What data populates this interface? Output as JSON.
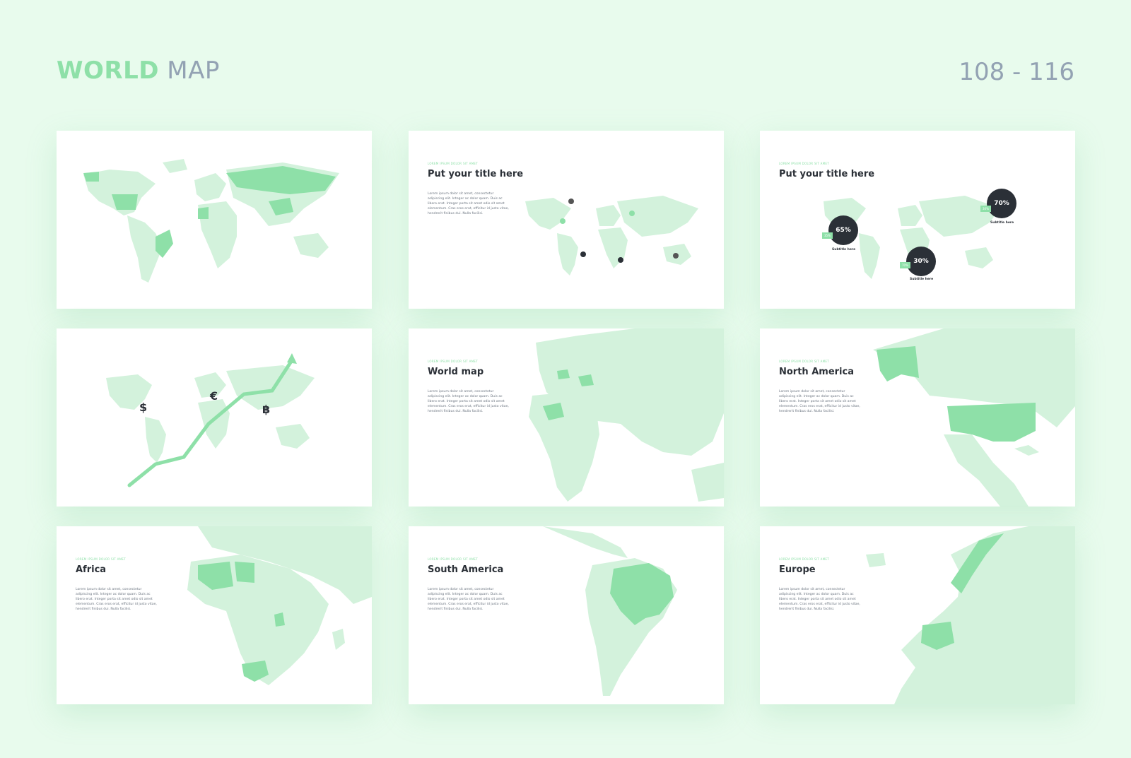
{
  "header": {
    "title_bold": "WORLD",
    "title_light": "MAP",
    "range": "108 - 116"
  },
  "colors": {
    "background": "#e8fbed",
    "accent": "#8ee0a8",
    "land": "#d3f2dc",
    "dark": "#2b3037"
  },
  "lorem_kicker": "LOREM IPSUM DOLOR SIT AMET",
  "lorem_body": "Lorem ipsum dolor sit amet, consectetur adipiscing elit. Integer ac dolor quam. Duis ac libero erat. Integer porta sit amet odio sit amet elementum. Cras eros erat, efficitur id justo vitae, hendrerit finibus dui. Nulla facilisi.",
  "slides": [
    {
      "id": "world-highlight"
    },
    {
      "id": "pins",
      "title": "Put your title here"
    },
    {
      "id": "bubbles",
      "title": "Put your title here",
      "bubbles": [
        {
          "value": "65%",
          "tag": "35%",
          "subtitle": "Subtitle here"
        },
        {
          "value": "70%",
          "tag": "30%",
          "subtitle": "Subtitle here"
        },
        {
          "value": "30%",
          "tag": "70%",
          "subtitle": "Subtitle here"
        }
      ]
    },
    {
      "id": "currency",
      "symbols": [
        "$",
        "€",
        "฿"
      ]
    },
    {
      "id": "world-map",
      "title": "World map"
    },
    {
      "id": "north-america",
      "title": "North America"
    },
    {
      "id": "africa",
      "title": "Africa"
    },
    {
      "id": "south-america",
      "title": "South America"
    },
    {
      "id": "europe",
      "title": "Europe"
    }
  ]
}
